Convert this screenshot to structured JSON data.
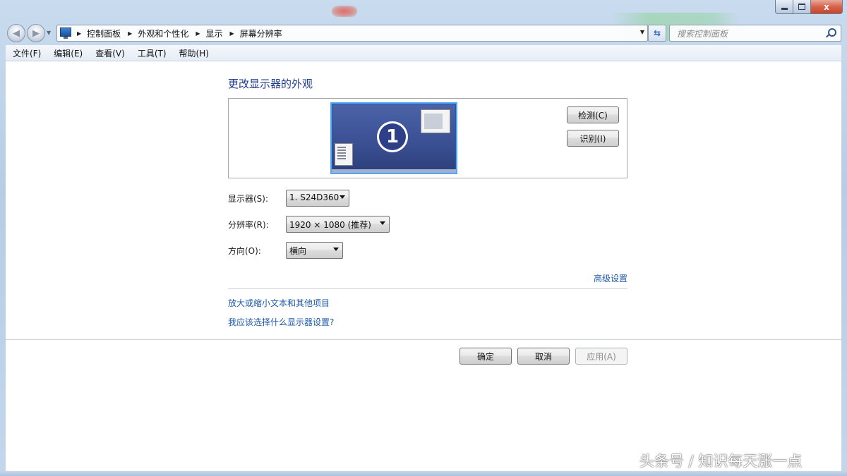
{
  "window": {
    "caption_buttons": {
      "minimize": "",
      "maximize": "",
      "close": "x"
    }
  },
  "address_bar": {
    "breadcrumbs": [
      "控制面板",
      "外观和个性化",
      "显示",
      "屏幕分辨率"
    ],
    "search_placeholder": "搜索控制面板"
  },
  "menu": {
    "items": [
      "文件(F)",
      "编辑(E)",
      "查看(V)",
      "工具(T)",
      "帮助(H)"
    ]
  },
  "main": {
    "title": "更改显示器的外观",
    "monitor_badge": "1",
    "detect_label": "检测(C)",
    "identify_label": "识别(I)",
    "fields": {
      "display_label": "显示器(S):",
      "display_value": "1. S24D360",
      "resolution_label": "分辨率(R):",
      "resolution_value": "1920 × 1080 (推荐)",
      "orientation_label": "方向(O):",
      "orientation_value": "横向"
    },
    "advanced_link": "高级设置",
    "links": {
      "text_size": "放大或缩小文本和其他项目",
      "which_settings": "我应该选择什么显示器设置?"
    },
    "buttons": {
      "ok": "确定",
      "cancel": "取消",
      "apply": "应用(A)"
    }
  },
  "watermark": "头条号 / 知识每天涨一点",
  "colors": {
    "link": "#1f5ba8",
    "title": "#1e3c8c",
    "monitor_fill": "#3a4f92",
    "monitor_border": "#57a7f0"
  },
  "icons": {
    "back": "back-arrow-icon",
    "forward": "forward-arrow-icon",
    "computer": "computer-icon",
    "refresh": "refresh-icon",
    "search": "search-icon"
  }
}
